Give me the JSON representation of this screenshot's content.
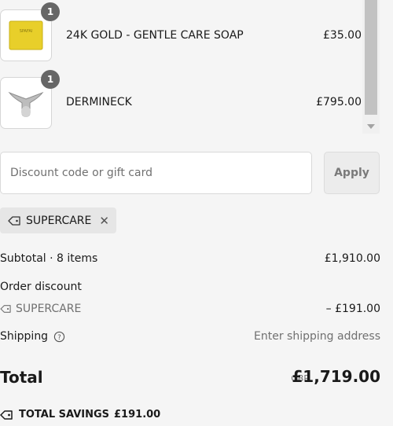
{
  "items": [
    {
      "name": "24K GOLD - GENTLE CARE SOAP",
      "price": "£35.00",
      "quantity": "1",
      "image_label": "SPAFAI"
    },
    {
      "name": "DERMINECK",
      "price": "£795.00",
      "quantity": "1"
    }
  ],
  "discount": {
    "placeholder": "Discount code or gift card",
    "apply_label": "Apply",
    "applied_code": "SUPERCARE"
  },
  "summary": {
    "subtotal_label": "Subtotal · 8 items",
    "subtotal_value": "£1,910.00",
    "order_discount_label": "Order discount",
    "discount_code": "SUPERCARE",
    "discount_value": "– £191.00",
    "shipping_label": "Shipping",
    "shipping_value": "Enter shipping address",
    "total_label": "Total",
    "total_currency": "GBP",
    "total_value": "£1,719.00",
    "savings_label": "TOTAL SAVINGS",
    "savings_value": "£191.00"
  },
  "icons": {
    "tag": "tag-icon",
    "help": "question-circle-icon",
    "close": "close-icon"
  },
  "colors": {
    "badge": "#666666",
    "soap": "#e8cf2a",
    "page_bg": "#f5f5f5"
  }
}
